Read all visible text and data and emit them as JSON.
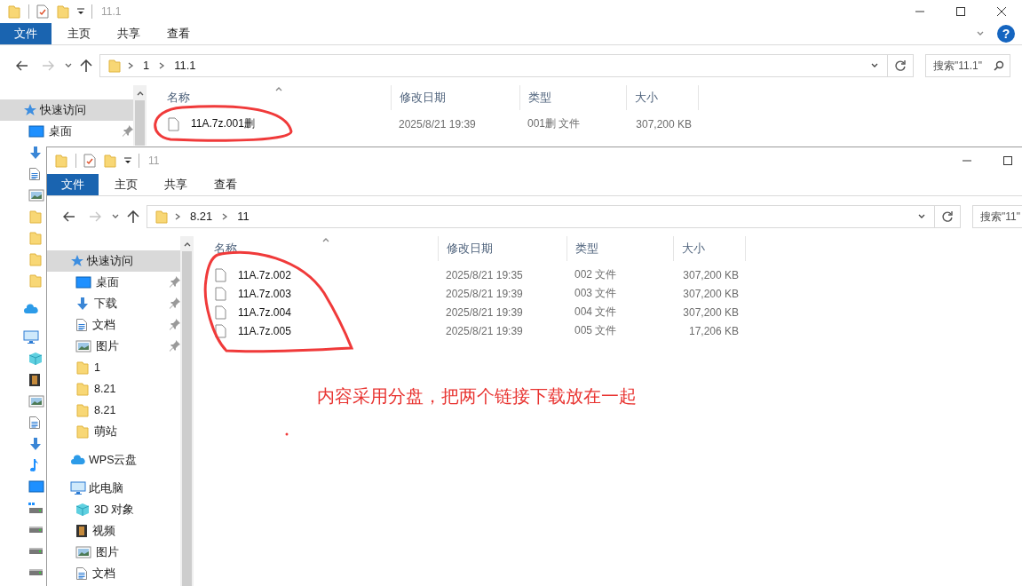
{
  "windows": [
    {
      "title": "11.1",
      "help_label": "?",
      "forward_disabled": true,
      "ribbon_tabs": [
        {
          "label": "文件",
          "selected": true
        },
        {
          "label": "主页",
          "selected": false
        },
        {
          "label": "共享",
          "selected": false
        },
        {
          "label": "查看",
          "selected": false
        }
      ],
      "path": [
        "1",
        "11.1"
      ],
      "search": {
        "placeholder": "搜索\"11.1\""
      },
      "nav": [
        {
          "kind": "star",
          "label": "快速访问",
          "selected": true,
          "children": [
            {
              "kind": "desktop",
              "label": "桌面",
              "pinned": true,
              "selected": false
            },
            {
              "kind": "download",
              "selected": false
            },
            {
              "kind": "document",
              "selected": false
            },
            {
              "kind": "picture",
              "selected": false
            },
            {
              "kind": "folder",
              "selected": false
            },
            {
              "kind": "folder",
              "selected": false
            },
            {
              "kind": "folder",
              "selected": false
            },
            {
              "kind": "folder",
              "selected": false
            }
          ]
        },
        {
          "kind": "cloud",
          "selected": false
        },
        {
          "kind": "pc",
          "selected": false,
          "children": [
            {
              "kind": "cube",
              "selected": false
            },
            {
              "kind": "video",
              "selected": false
            },
            {
              "kind": "picture",
              "selected": false
            },
            {
              "kind": "document",
              "selected": false
            },
            {
              "kind": "download",
              "selected": false
            },
            {
              "kind": "music",
              "selected": false
            },
            {
              "kind": "desktop",
              "selected": false
            },
            {
              "kind": "windrive",
              "selected": false
            },
            {
              "kind": "drive",
              "selected": false
            },
            {
              "kind": "drive",
              "selected": false
            },
            {
              "kind": "drive",
              "selected": false
            }
          ]
        }
      ],
      "columns": [
        "名称",
        "修改日期",
        "类型",
        "大小"
      ],
      "rows": [
        {
          "name": "11A.7z.001删",
          "date": "2025/8/21 19:39",
          "type": "001删 文件",
          "size": "307,200 KB"
        }
      ]
    },
    {
      "title": "11",
      "forward_disabled": true,
      "ribbon_tabs": [
        {
          "label": "文件",
          "selected": true
        },
        {
          "label": "主页",
          "selected": false
        },
        {
          "label": "共享",
          "selected": false
        },
        {
          "label": "查看",
          "selected": false
        }
      ],
      "path": [
        "8.21",
        "11"
      ],
      "search": {
        "placeholder": "搜索\"11\""
      },
      "nav": [
        {
          "kind": "star",
          "label": "快速访问",
          "selected": true,
          "children": [
            {
              "kind": "desktop",
              "label": "桌面",
              "pinned": true,
              "selected": false
            },
            {
              "kind": "download",
              "label": "下载",
              "pinned": true,
              "selected": false
            },
            {
              "kind": "document",
              "label": "文档",
              "pinned": true,
              "selected": false
            },
            {
              "kind": "picture",
              "label": "图片",
              "pinned": true,
              "selected": false
            },
            {
              "kind": "folder",
              "label": "1",
              "selected": false
            },
            {
              "kind": "folder",
              "label": "8.21",
              "selected": false
            },
            {
              "kind": "folder",
              "label": "8.21",
              "selected": false
            },
            {
              "kind": "folder",
              "label": "萌站",
              "selected": false
            }
          ]
        },
        {
          "kind": "cloud",
          "label": "WPS云盘",
          "selected": false
        },
        {
          "kind": "pc",
          "label": "此电脑",
          "selected": false,
          "children": [
            {
              "kind": "cube",
              "label": "3D 对象",
              "selected": false
            },
            {
              "kind": "video",
              "label": "视频",
              "selected": false
            },
            {
              "kind": "picture",
              "label": "图片",
              "selected": false
            },
            {
              "kind": "document",
              "label": "文档",
              "selected": false
            }
          ]
        }
      ],
      "columns": [
        "名称",
        "修改日期",
        "类型",
        "大小"
      ],
      "rows": [
        {
          "name": "11A.7z.002",
          "date": "2025/8/21 19:35",
          "type": "002 文件",
          "size": "307,200 KB"
        },
        {
          "name": "11A.7z.003",
          "date": "2025/8/21 19:39",
          "type": "003 文件",
          "size": "307,200 KB"
        },
        {
          "name": "11A.7z.004",
          "date": "2025/8/21 19:39",
          "type": "004 文件",
          "size": "307,200 KB"
        },
        {
          "name": "11A.7z.005",
          "date": "2025/8/21 19:39",
          "type": "005 文件",
          "size": "17,206 KB"
        }
      ]
    }
  ],
  "annotation": {
    "text": "内容采用分盘，把两个链接下载放在一起"
  }
}
